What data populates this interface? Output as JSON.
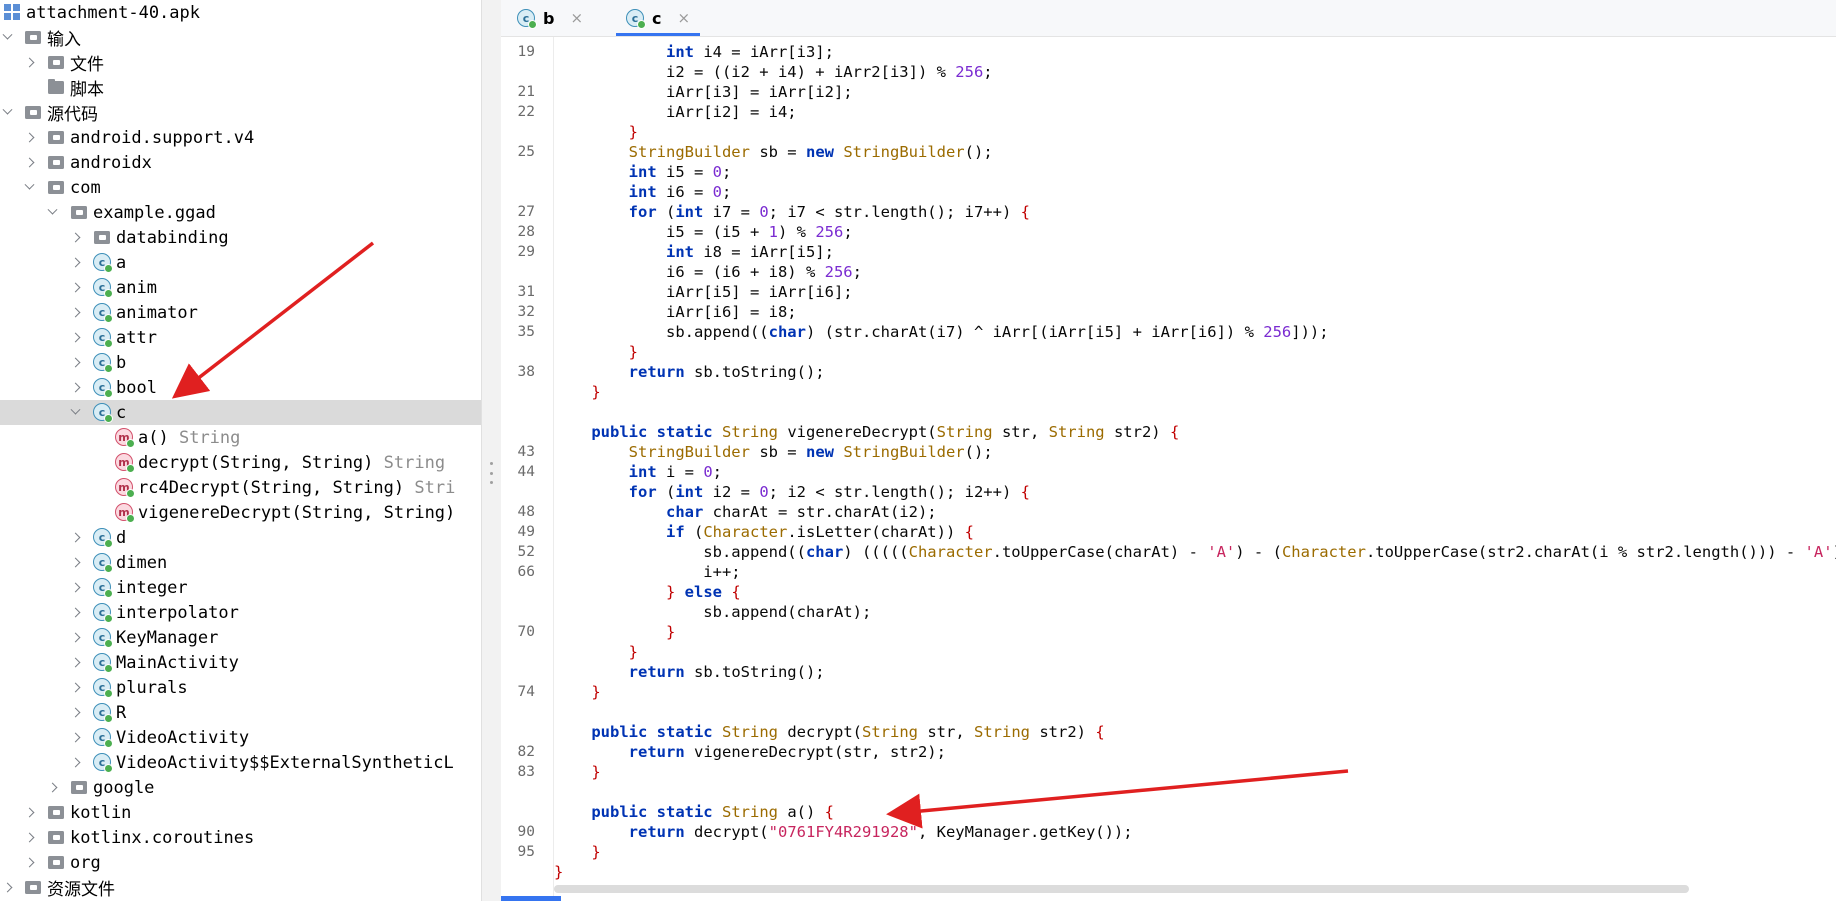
{
  "tree": {
    "rows": [
      {
        "label": "attachment-40.apk",
        "type": ""
      },
      {
        "label": "输入",
        "type": ""
      },
      {
        "label": "文件",
        "type": ""
      },
      {
        "label": "脚本",
        "type": ""
      },
      {
        "label": "源代码",
        "type": ""
      },
      {
        "label": "android.support.v4",
        "type": ""
      },
      {
        "label": "androidx",
        "type": ""
      },
      {
        "label": "com",
        "type": ""
      },
      {
        "label": "example.ggad",
        "type": ""
      },
      {
        "label": "databinding",
        "type": ""
      },
      {
        "label": "a",
        "type": ""
      },
      {
        "label": "anim",
        "type": ""
      },
      {
        "label": "animator",
        "type": ""
      },
      {
        "label": "attr",
        "type": ""
      },
      {
        "label": "b",
        "type": ""
      },
      {
        "label": "bool",
        "type": ""
      },
      {
        "label": "c",
        "type": ""
      },
      {
        "label": "a()",
        "type": "String"
      },
      {
        "label": "decrypt(String, String)",
        "type": "String"
      },
      {
        "label": "rc4Decrypt(String, String)",
        "type": "Stri"
      },
      {
        "label": "vigenereDecrypt(String, String)",
        "type": ""
      },
      {
        "label": "d",
        "type": ""
      },
      {
        "label": "dimen",
        "type": ""
      },
      {
        "label": "integer",
        "type": ""
      },
      {
        "label": "interpolator",
        "type": ""
      },
      {
        "label": "KeyManager",
        "type": ""
      },
      {
        "label": "MainActivity",
        "type": ""
      },
      {
        "label": "plurals",
        "type": ""
      },
      {
        "label": "R",
        "type": ""
      },
      {
        "label": "VideoActivity",
        "type": ""
      },
      {
        "label": "VideoActivity$$ExternalSyntheticL",
        "type": ""
      },
      {
        "label": "google",
        "type": ""
      },
      {
        "label": "kotlin",
        "type": ""
      },
      {
        "label": "kotlinx.coroutines",
        "type": ""
      },
      {
        "label": "org",
        "type": ""
      },
      {
        "label": "资源文件",
        "type": ""
      }
    ]
  },
  "tabs": [
    {
      "label": "b",
      "icon": "class-icon",
      "close": "×"
    },
    {
      "label": "c",
      "icon": "class-icon",
      "close": "×"
    }
  ],
  "class_icon_letter": "c",
  "method_icon_letter": "m",
  "line_numbers": [
    "19",
    "",
    "21",
    "22",
    "",
    "25",
    "",
    "",
    "27",
    "28",
    "29",
    "",
    "31",
    "32",
    "35",
    "",
    "38",
    "",
    "",
    "",
    "43",
    "44",
    "",
    "48",
    "49",
    "52",
    "66",
    "",
    "",
    "70",
    "",
    "",
    "74",
    "",
    "",
    "82",
    "83",
    "",
    "",
    "90",
    "95",
    "",
    ""
  ],
  "colors": {
    "keyword": "#0033b3",
    "type": "#9b6b00",
    "number": "#7a2bd1",
    "string": "#c7255e",
    "accent": "#3574f0",
    "arrow": "#e02020",
    "selection": "#dadada"
  }
}
